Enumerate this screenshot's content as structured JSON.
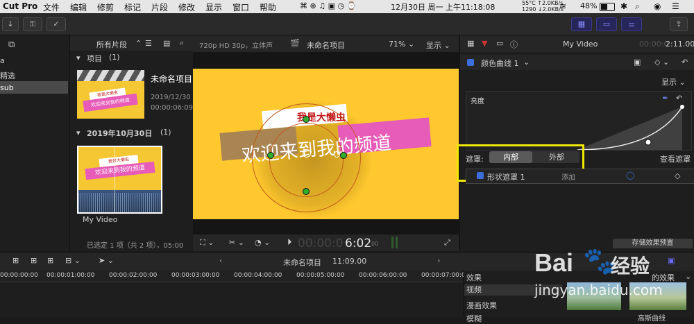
{
  "menubar": {
    "app": "Cut Pro",
    "menus": [
      "文件",
      "编辑",
      "修剪",
      "标记",
      "片段",
      "修改",
      "显示",
      "窗口",
      "帮助"
    ],
    "sensors": [
      "55°C ↑2.0KB/s",
      "1290 ↓2.0KB/s"
    ],
    "clock": "12月30日 周一 上午11:18:08",
    "battery": "48%"
  },
  "browser": {
    "filter": "所有片段",
    "sidebar_items": [
      "a",
      "精选",
      "sub"
    ],
    "section1_title": "项目",
    "section1_count": "(1)",
    "project_title": "未命名项目",
    "project_date": "2019/12/30 11",
    "project_time": "00:00:06:09.0",
    "thumb_small_text": "我是大懒虫",
    "thumb_big_text": "欢迎来到我的频道",
    "section2_title": "2019年10月30日",
    "section2_count": "(1)",
    "clip_name": "My Video",
    "status": "已选定 1 项（共 2 项），05:00"
  },
  "viewer": {
    "format": "720p HD 30p，立体声",
    "project": "未命名项目",
    "zoom": "71%",
    "display": "显示",
    "title_small": "我是大懒虫",
    "title_big": "欢迎来到我的频道",
    "timecode_dim": "00:00:0",
    "timecode": "6:02",
    "timecode_frames": "00"
  },
  "inspector": {
    "clip_title": "My Video",
    "duration": "2:11.00",
    "timecode_dim": "00:00:0",
    "effect_name": "颜色曲线 1",
    "display_btn": "显示",
    "curve_label": "亮度",
    "mask_label": "遮罩:",
    "mask_inner": "内部",
    "mask_outer": "外部",
    "view_mask": "查看遮罩",
    "shape_mask": "形状遮罩 1",
    "add": "添加",
    "save_preset": "存储效果预置"
  },
  "timeline": {
    "project": "未命名项目",
    "duration": "11:09.00",
    "ruler": [
      "00:00:00:00",
      "00:00:01:00:00",
      "00:00:02:00:00",
      "00:00:03:00:00",
      "00:00:04:00:00",
      "00:00:05:00:00",
      "00:00:06:00:00",
      "00:00:07:00:00"
    ]
  },
  "effects": {
    "title": "效果",
    "categories": [
      "视频",
      "漫画效果",
      "模糊"
    ],
    "right_title": "的效果",
    "thumb_label": "高斯曲线"
  },
  "watermark": {
    "brand": "Bai",
    "brand2": "经验",
    "url": "jingyan.baidu.com"
  }
}
